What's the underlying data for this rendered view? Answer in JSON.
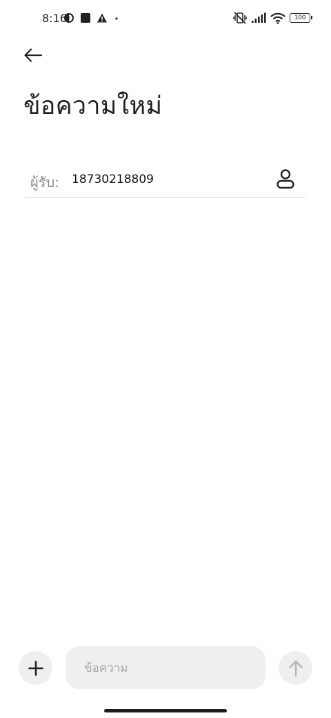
{
  "status_bar": {
    "time": "8:16",
    "battery": "100",
    "icons_left": [
      "data-saver-icon",
      "square-notification-icon",
      "warning-icon",
      "dot-icon"
    ],
    "icons_right": [
      "vibrate-off-icon",
      "signal-icon",
      "wifi-icon",
      "battery-icon"
    ]
  },
  "header": {
    "back_icon": "arrow-left-icon",
    "title": "ข้อความใหม่"
  },
  "recipient": {
    "label": "ผู้รับ:",
    "value": "18730218809",
    "contact_icon": "person-icon"
  },
  "composer": {
    "attach_icon": "plus-icon",
    "placeholder": "ข้อความ",
    "value": "",
    "send_icon": "arrow-up-icon",
    "send_enabled": false
  },
  "colors": {
    "background": "#ffffff",
    "text": "#222222",
    "muted": "#8a8a8a",
    "field_bg": "#efefef",
    "divider": "#d9d9d9",
    "send_disabled": "#b5b5b5"
  }
}
